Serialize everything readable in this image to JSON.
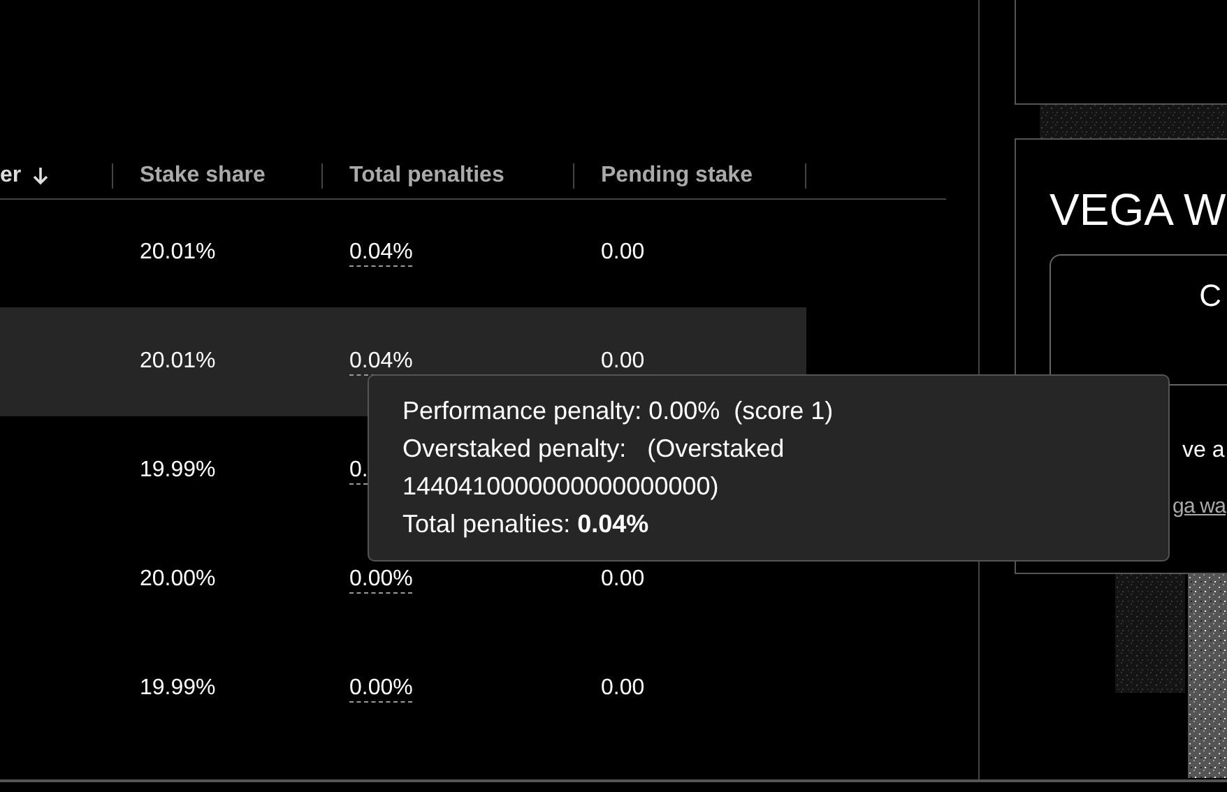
{
  "table": {
    "columns": [
      {
        "label": "er",
        "sorted": true
      },
      {
        "label": "Stake share",
        "sorted": false
      },
      {
        "label": "Total penalties",
        "sorted": false
      },
      {
        "label": "Pending stake",
        "sorted": false
      }
    ],
    "rows": [
      {
        "stake_share": "20.01%",
        "total_penalties": "0.04%",
        "pending_stake": "0.00",
        "highlighted": false
      },
      {
        "stake_share": "20.01%",
        "total_penalties": "0.04%",
        "pending_stake": "0.00",
        "highlighted": true
      },
      {
        "stake_share": "19.99%",
        "total_penalties": "0.",
        "highlighted": false
      },
      {
        "stake_share": "20.00%",
        "total_penalties": "0.00%",
        "pending_stake": "0.00",
        "highlighted": false
      },
      {
        "stake_share": "19.99%",
        "total_penalties": "0.00%",
        "pending_stake": "0.00",
        "highlighted": false
      }
    ]
  },
  "tooltip": {
    "lines": [
      "Performance penalty: 0.00%  (score 1)",
      "Overstaked penalty:   (Overstaked 1440410000000000000000)",
      "Total penalties: **0.04%**"
    ]
  },
  "side_panel": {
    "title": "VEGA W",
    "card_text": "C",
    "body_text": "ve a",
    "link": "ga wa"
  }
}
